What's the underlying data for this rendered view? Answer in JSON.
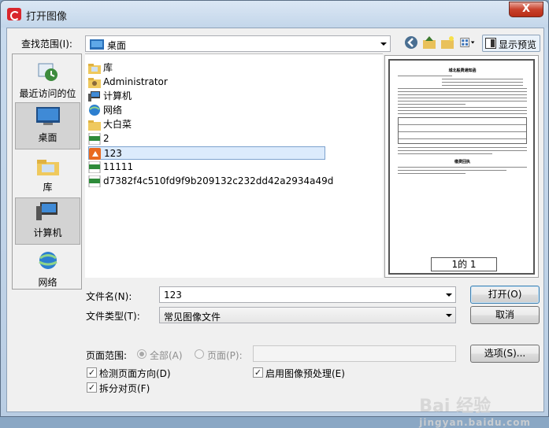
{
  "window": {
    "title": "打开图像",
    "close_label": "X"
  },
  "toolbar": {
    "lookin_label": "查找范围(I):",
    "lookin_value": "桌面",
    "preview_toggle_label": "显示预览"
  },
  "places": [
    {
      "label": "最近访问的位置",
      "icon": "recent-places-icon"
    },
    {
      "label": "桌面",
      "icon": "desktop-icon"
    },
    {
      "label": "库",
      "icon": "library-icon"
    },
    {
      "label": "计算机",
      "icon": "computer-icon"
    },
    {
      "label": "网络",
      "icon": "network-icon"
    }
  ],
  "files": [
    {
      "name": "库",
      "icon": "library-folder-icon"
    },
    {
      "name": "Administrator",
      "icon": "user-folder-icon"
    },
    {
      "name": "计算机",
      "icon": "computer-icon"
    },
    {
      "name": "网络",
      "icon": "network-icon"
    },
    {
      "name": "大白菜",
      "icon": "folder-icon"
    },
    {
      "name": "2",
      "icon": "jpeg-file-icon"
    },
    {
      "name": "123",
      "icon": "image-file-icon",
      "selected": true
    },
    {
      "name": "11111",
      "icon": "jpeg-file-icon"
    },
    {
      "name": "d7382f4c510fd9f9b209132c232dd42a2934a49d",
      "icon": "jpeg-file-icon"
    }
  ],
  "preview": {
    "page_indicator": "1的 1",
    "doc_title": "城北般费通知函",
    "doc_section": "缴费通知",
    "doc_heading2": "缴费回执"
  },
  "form": {
    "filename_label": "文件名(N):",
    "filename_value": "123",
    "filetype_label": "文件类型(T):",
    "filetype_value": "常见图像文件",
    "open_label": "打开(O)",
    "cancel_label": "取消",
    "page_range_label": "页面范围:",
    "all_label": "全部(A)",
    "pages_label": "页面(P):",
    "options_label": "选项(S)...",
    "detect_orientation_label": "检测页面方向(D)",
    "enable_preprocess_label": "启用图像预处理(E)",
    "split_pages_label": "拆分对页(F)"
  },
  "watermark": {
    "text": "Bai 经验",
    "sub": "jingyan.baidu.com"
  },
  "colors": {
    "selection": "#dcebfc",
    "selection_border": "#7da2ce",
    "close": "#c8412c"
  }
}
